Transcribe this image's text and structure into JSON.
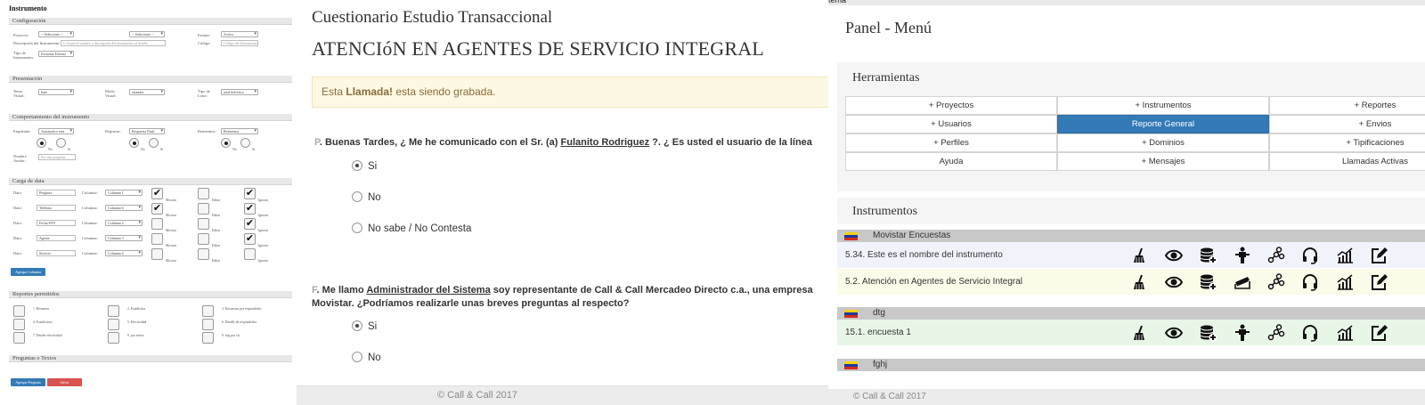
{
  "left": {
    "title": "Instrumento",
    "sections": {
      "config": "Configuración",
      "presentacion": "Presentación",
      "comportamiento": "Comportamiento del instrumento",
      "carga": "Carga de data",
      "reportes": "Reportes permitidos",
      "preguntas": "Preguntas o Textos"
    },
    "config": {
      "proyecto_label": "Proyecto:",
      "proyecto_value": "-- Seleccione --",
      "estatus_label": "Estatus:",
      "estatus_value": "Activo",
      "descripcion_label": "Descripción del Instrumento:",
      "descripcion_placeholder": "Coloque el nombre y descripción del instrumento al detalle",
      "codigo_label": "Código:",
      "codigo_placeholder": "Código del Instrumento",
      "tipo_label": "Tipo de Instrumento:",
      "tipo_value": "Encuesta Externa"
    },
    "presentacion": {
      "tema_label": "Tema Visual:",
      "tema_value": "base",
      "modo_label": "Modo Visual:",
      "modo_value": "estandar",
      "tipo_label": "Tipo de Letra:",
      "tipo_value": "arial helvetica"
    },
    "comportamiento": {
      "emp_label": "Empleado:",
      "emp_value": "Automatico ems",
      "reg_label": "Registrar:",
      "reg_value": "Respuesta Final",
      "rep_label": "Reintentos:",
      "rep_value": "Reintentos",
      "nombre_label": "Nombre Anular:",
      "nombre_placeholder": "Por una pregunta",
      "no": "No",
      "si": "Si"
    },
    "carga": {
      "rows": [
        {
          "dato_label": "Dato:",
          "dato": "Pregunta",
          "col_label": "Columna:",
          "col": "Columna 1"
        },
        {
          "dato_label": "Dato:",
          "dato": "Teléfono",
          "col_label": "Columna:",
          "col": "Columna 6"
        },
        {
          "dato_label": "Dato:",
          "dato": "Fecha ENT",
          "col_label": "Columna:",
          "col": "Columna 2"
        },
        {
          "dato_label": "Dato:",
          "dato": "Agente",
          "col_label": "Columna:",
          "col": "Columna 3"
        },
        {
          "dato_label": "Dato:",
          "dato": "Servicio",
          "col_label": "Columna:",
          "col": "Columna 4"
        }
      ],
      "cb1": "Mostrar",
      "cb2": "Editar",
      "cb3": "Ignorar",
      "add_button": "Agregar Columna"
    },
    "reportes": [
      "1. Resumen",
      "2. Estadística",
      "3. Encuestas por respondedor",
      "4. Estadísticas",
      "5. Efectividad",
      "6. Detalle de respondedor",
      "7. Detalle efectividad",
      "8. por textos",
      "9. rfig por sft"
    ],
    "buttons": {
      "add": "Agregar Pregunta",
      "cancel": "Salvar"
    }
  },
  "mid": {
    "title": "Cuestionario Estudio Transaccional",
    "subtitle": "ATENCIóN EN AGENTES DE SERVICIO INTEGRAL",
    "alert_pre": "Esta ",
    "alert_bold": "Llamada!",
    "alert_post": " esta siendo grabada.",
    "q1": {
      "prefix": "P",
      "part1": ". Buenas Tardes, ¿ Me he comunicado con el Sr. (a) ",
      "name": "Fulanito Rodriguez",
      "part2": " ?. ¿ Es usted el usuario de la línea",
      "options": [
        "Si",
        "No",
        "No sabe / No Contesta"
      ]
    },
    "q2": {
      "prefix": "F",
      "part1": ". Me llamo ",
      "name": "Administrador del Sistema",
      "part2": " soy representante de Call & Call Mercadeo Directo c.a., una empresa",
      "line2": "Movistar. ¿Podríamos realizarle unas breves preguntas al respecto?",
      "options": [
        "Si",
        "No"
      ]
    },
    "footer": "© Call & Call 2017"
  },
  "right": {
    "topbar": "tema",
    "title": "Panel - Menú",
    "herramientas": "Herramientas",
    "menu": [
      [
        "+ Proyectos",
        "+ Instrumentos",
        "+ Reportes"
      ],
      [
        "+ Usuarios",
        "Reporte General",
        "+ Envios"
      ],
      [
        "+ Perfiles",
        "+ Dominios",
        "+ Tipificaciones"
      ],
      [
        "Ayuda",
        "+ Mensajes",
        "Llamadas Activas"
      ]
    ],
    "instrumentos": "Instrumentos",
    "groups": {
      "g1": "Movistar Encuestas",
      "g1r1": "5.34.  Este es el nombre del instrumento",
      "g1r2": "5.2.  Atención en Agentes de Servicio Integral",
      "g2": "dtg",
      "g2r1": "15.1.  encuesta 1",
      "g3": "fghj"
    },
    "footer": "© Call & Call 2017",
    "colors": {
      "active": "#337ab7",
      "row1": "#f1f3fb",
      "row2": "#fbfbe9",
      "row3": "#e8f6e8"
    }
  }
}
